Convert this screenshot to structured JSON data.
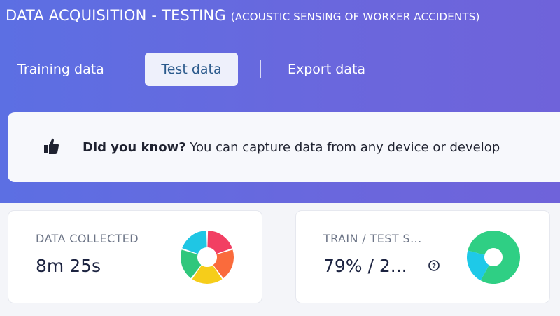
{
  "header": {
    "title": "DATA ACQUISITION - TESTING",
    "subtitle": "(ACOUSTIC SENSING OF WORKER ACCIDENTS)"
  },
  "tabs": [
    {
      "label": "Training data",
      "active": false
    },
    {
      "label": "Test data",
      "active": true
    },
    {
      "label": "Export data",
      "active": false
    }
  ],
  "tip": {
    "icon": "thumbs-up-icon",
    "bold": "Did you know?",
    "text": " You can capture data from any device or develop"
  },
  "cards": {
    "data_collected": {
      "label": "DATA COLLECTED",
      "value": "8m 25s",
      "icon": "multicolor-donut-icon",
      "slice_colors": [
        "#f23f63",
        "#fa6b3c",
        "#f6cd1a",
        "#30c77c",
        "#1fc6e4"
      ]
    },
    "train_test_split": {
      "label": "TRAIN / TEST S...",
      "value": "79% / 2...",
      "help_icon": "question-circle-icon",
      "icon": "split-donut-icon",
      "split": [
        0.79,
        0.21
      ],
      "split_colors": [
        "#2fcf84",
        "#1ec9e8"
      ]
    }
  },
  "colors": {
    "hero_start": "#5c6fe3",
    "hero_end": "#6f63da",
    "active_tab_text": "#2b5a8c"
  }
}
